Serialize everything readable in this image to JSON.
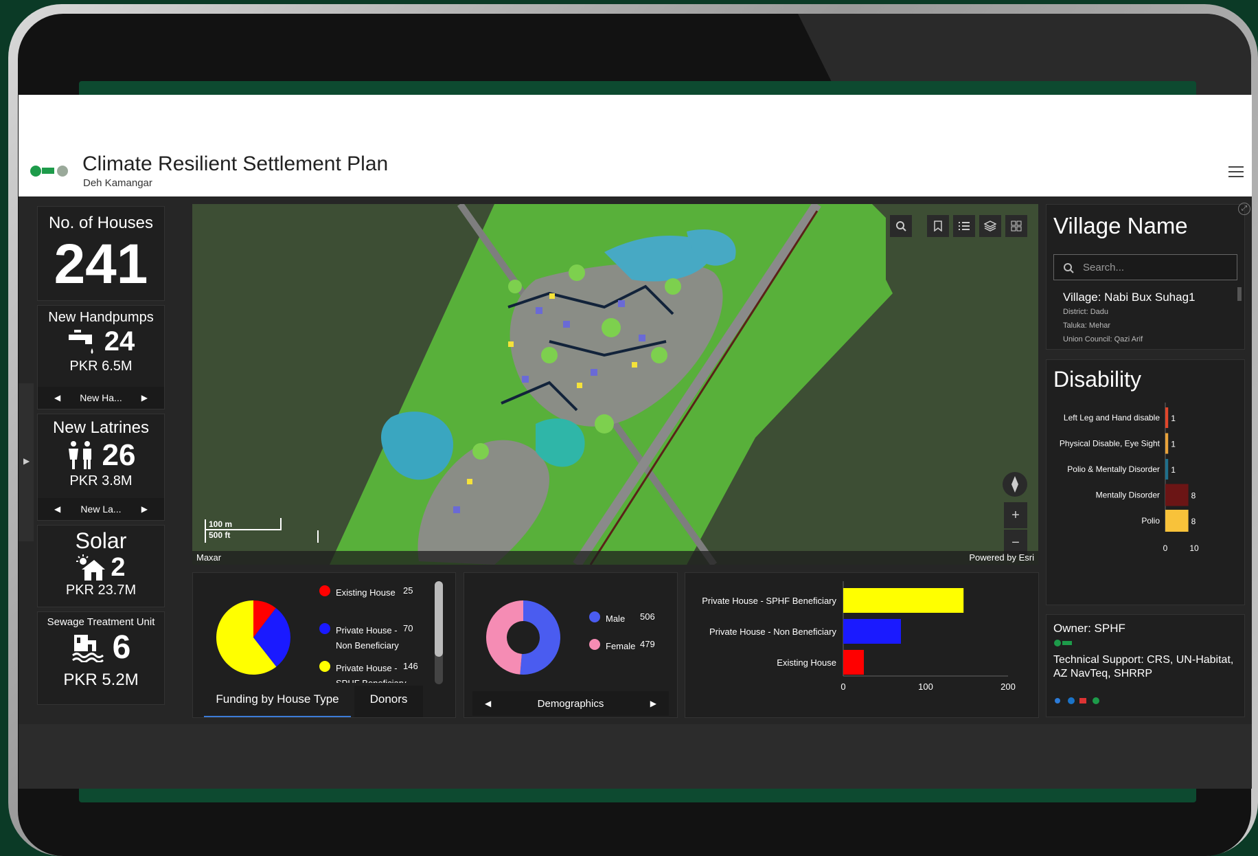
{
  "header": {
    "title": "Climate Resilient Settlement Plan",
    "subtitle": "Deh Kamangar"
  },
  "kpis": {
    "houses": {
      "label": "No. of Houses",
      "value": "241"
    },
    "handpumps": {
      "label": "New Handpumps",
      "value": "24",
      "cost": "PKR 6.5M",
      "nav_label": "New Ha..."
    },
    "latrines": {
      "label": "New Latrines",
      "value": "26",
      "cost": "PKR 3.8M",
      "nav_label": "New La..."
    },
    "solar": {
      "label": "Solar",
      "value": "2",
      "cost": "PKR 23.7M"
    },
    "sewage": {
      "label": "Sewage Treatment Unit",
      "value": "6",
      "cost": "PKR 5.2M"
    }
  },
  "map": {
    "scale_m": "100 m",
    "scale_ft": "500 ft",
    "attribution_left": "Maxar",
    "attribution_right": "Powered by Esri",
    "zoom_in": "+",
    "zoom_out": "−"
  },
  "village": {
    "title": "Village Name",
    "search_placeholder": "Search...",
    "name": "Village: Nabi Bux Suhag1",
    "district": "District: Dadu",
    "taluka": "Taluka: Mehar",
    "union_council": "Union Council: Qazi Arif"
  },
  "disability": {
    "title": "Disability",
    "x_ticks": [
      "0",
      "10"
    ],
    "items": [
      {
        "label": "Left Leg and Hand disable",
        "value": 1,
        "color": "#e0462b"
      },
      {
        "label": "Physical Disable, Eye Sight",
        "value": 1,
        "color": "#e8a23a"
      },
      {
        "label": "Polio & Mentally Disorder",
        "value": 1,
        "color": "#1f6f8b"
      },
      {
        "label": "Mentally Disorder",
        "value": 8,
        "color": "#6b1515"
      },
      {
        "label": "Polio",
        "value": 8,
        "color": "#f8c23a"
      }
    ]
  },
  "funding": {
    "tabs": [
      "Funding by House Type",
      "Donors"
    ],
    "legend": [
      {
        "label": "Existing House",
        "value": "25",
        "color": "#ff0000"
      },
      {
        "label": "Private House - Non Beneficiary",
        "value": "70",
        "color": "#1a1aff"
      },
      {
        "label": "Private House - SPHF Beneficiary",
        "value": "146",
        "color": "#ffff00"
      }
    ]
  },
  "demographics": {
    "nav_label": "Demographics",
    "legend": [
      {
        "label": "Male",
        "value": "506",
        "color": "#4a5cf0"
      },
      {
        "label": "Female",
        "value": "479",
        "color": "#f58cb4"
      }
    ]
  },
  "house_bar": {
    "x_ticks": [
      "0",
      "100",
      "200"
    ]
  },
  "owner": {
    "owner": "Owner: SPHF",
    "support": "Technical Support: CRS, UN-Habitat, AZ NavTeq, SHRRP"
  },
  "chart_data": [
    {
      "type": "bar",
      "orientation": "horizontal",
      "title": "Disability",
      "categories": [
        "Left Leg and Hand disable",
        "Physical Disable, Eye Sight",
        "Polio & Mentally Disorder",
        "Mentally Disorder",
        "Polio"
      ],
      "values": [
        1,
        1,
        1,
        8,
        8
      ],
      "xlim": [
        0,
        12
      ]
    },
    {
      "type": "pie",
      "title": "",
      "categories": [
        "Existing House",
        "Private House - Non Beneficiary",
        "Private House - SPHF Beneficiary"
      ],
      "values": [
        25,
        70,
        146
      ]
    },
    {
      "type": "pie",
      "donut": true,
      "title": "",
      "categories": [
        "Male",
        "Female"
      ],
      "values": [
        506,
        479
      ]
    },
    {
      "type": "bar",
      "orientation": "horizontal",
      "title": "",
      "categories": [
        "Private House - SPHF Beneficiary",
        "Private House - Non Beneficiary",
        "Existing House"
      ],
      "values": [
        146,
        70,
        25
      ],
      "xlim": [
        0,
        200
      ]
    }
  ]
}
